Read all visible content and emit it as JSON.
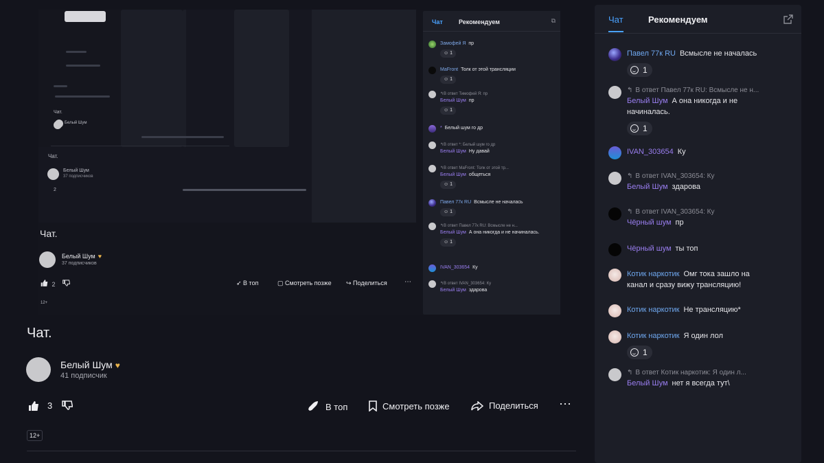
{
  "video": {
    "title": "Чат.",
    "channel": {
      "name": "Белый Шум",
      "subscribers": "41 подписчик"
    },
    "likes": "3",
    "actions": {
      "top": "В топ",
      "later": "Смотреть позже",
      "share": "Поделиться"
    },
    "age": "12+",
    "frame": {
      "title": "Чат.",
      "channel": {
        "name": "Белый Шум",
        "subscribers": "37 подписчиков"
      },
      "likes": "2",
      "actions": {
        "top": "В топ",
        "later": "Смотреть позже",
        "share": "Поделиться"
      },
      "age": "12+",
      "inner_title": "Чат.",
      "inner_channel": "Белый Шум",
      "inner_subs": "37 подписчиков",
      "inner_likes": "2",
      "chat": {
        "tabs": {
          "chat": "Чат",
          "recommend": "Рекомендуем"
        },
        "messages": [
          {
            "name": "Замофей Я",
            "text": "пр",
            "reaction": "1"
          },
          {
            "name": "MaFront",
            "text": "Толк от этой трансляции",
            "reaction": "1"
          },
          {
            "reply": "В ответ Тимофей Я: пр",
            "name": "Белый Шум",
            "text": "пр",
            "reaction": "1"
          },
          {
            "name": "*",
            "text": "Белый шум го др"
          },
          {
            "reply": "В ответ *: Белый шум го др",
            "name": "Белый Шум",
            "text": "Ну давай"
          },
          {
            "reply": "В ответ MaFront: Толк от этой тр...",
            "name": "Белый Шум",
            "text": "общеться",
            "reaction": "1"
          },
          {
            "name": "Павел 77к RU",
            "text": "Всмысле не началась",
            "reaction": "1"
          },
          {
            "reply": "В ответ Павел 77к RU: Всмысле не н...",
            "name": "Белый Шум",
            "text": "А она никогда и не начиналась.",
            "reaction": "1"
          },
          {
            "name": "IVAN_303654",
            "text": "Ку"
          },
          {
            "reply": "В ответ IVAN_303654: Ку",
            "name": "Белый Шум",
            "text": "здарова"
          }
        ]
      }
    }
  },
  "chat": {
    "tabs": {
      "chat": "Чат",
      "recommend": "Рекомендуем"
    },
    "messages": [
      {
        "name": "Павел 77к RU",
        "text": "Всмысле не началась",
        "reaction": "1"
      },
      {
        "reply": "В ответ Павел 77к RU: Всмысле не н...",
        "name": "Белый Шум",
        "text": "А она никогда и не",
        "text2": "начиналась.",
        "reaction": "1"
      },
      {
        "name": "IVAN_303654",
        "text": "Ку"
      },
      {
        "reply": "В ответ IVAN_303654: Ку",
        "name": "Белый Шум",
        "text": "здарова"
      },
      {
        "reply": "В ответ IVAN_303654: Ку",
        "name": "Чёрный шум",
        "text": "пр"
      },
      {
        "name": "Чёрный шум",
        "text": "ты топ"
      },
      {
        "name": "Котик наркотик",
        "text": "Омг тока зашло на",
        "text2": "канал и сразу вижу трансляцию!"
      },
      {
        "name": "Котик наркотик",
        "text": "Не трансляцию*"
      },
      {
        "name": "Котик наркотик",
        "text": "Я один лол",
        "reaction": "1"
      },
      {
        "reply": "В ответ Котик наркотик: Я один л...",
        "name": "Белый Шум",
        "text": "нет я всегда тут\\"
      }
    ]
  },
  "colors": {
    "accent": "#4aa2ff",
    "name_blue": "#6fa8f0",
    "name_purple": "#9a7ef0",
    "heart": "#e8b34c"
  },
  "icons": [
    "like-icon",
    "dislike-icon",
    "rocket-icon",
    "bookmark-icon",
    "share-icon",
    "more-icon",
    "popout-icon",
    "emoji-icon"
  ]
}
